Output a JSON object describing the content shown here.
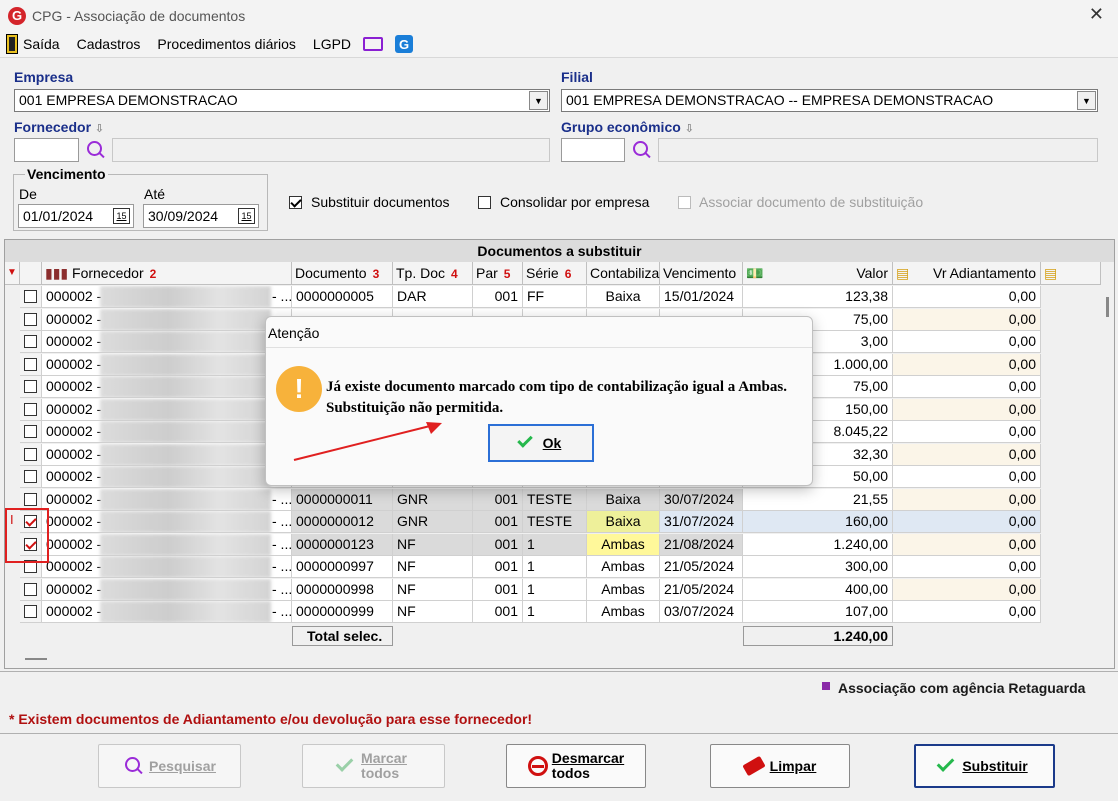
{
  "window": {
    "title": "CPG - Associação de documentos"
  },
  "menu": {
    "items": [
      "Saída",
      "Cadastros",
      "Procedimentos diários",
      "LGPD"
    ]
  },
  "empresa": {
    "label": "Empresa",
    "value": "001 EMPRESA DEMONSTRACAO"
  },
  "filial": {
    "label": "Filial",
    "value": "001 EMPRESA DEMONSTRACAO -- EMPRESA DEMONSTRACAO"
  },
  "fornecedor": {
    "label": "Fornecedor"
  },
  "grupo": {
    "label": "Grupo econômico"
  },
  "vencimento": {
    "label": "Vencimento",
    "de_label": "De",
    "de_value": "01/01/2024",
    "ate_label": "Até",
    "ate_value": "30/09/2024",
    "cal": "15"
  },
  "options": {
    "substituir": "Substituir documentos",
    "consolidar": "Consolidar por empresa",
    "associar": "Associar documento de substituição"
  },
  "grid": {
    "title": "Documentos a substituir",
    "headers": {
      "fornecedor": "Fornecedor",
      "documento": "Documento",
      "tpdoc": "Tp. Doc",
      "par": "Par",
      "serie": "Série",
      "contabiliza": "Contabiliza",
      "vencimento": "Vencimento",
      "valor": "Valor",
      "vradiant": "Vr Adiantamento"
    },
    "rows": [
      {
        "forn": "000002 -",
        "tail": "- ...",
        "doc": "0000000005",
        "tp": "DAR",
        "par": "001",
        "serie": "FF",
        "cont": "Baixa",
        "venc": "15/01/2024",
        "valor": "123,38",
        "vr": "0,00"
      },
      {
        "forn": "000002 -",
        "tail": "",
        "doc": "",
        "tp": "",
        "par": "",
        "serie": "",
        "cont": "",
        "venc": "",
        "valor": "75,00",
        "vr": "0,00"
      },
      {
        "forn": "000002 -",
        "tail": "",
        "doc": "",
        "tp": "",
        "par": "",
        "serie": "",
        "cont": "",
        "venc": "",
        "valor": "3,00",
        "vr": "0,00"
      },
      {
        "forn": "000002 -",
        "tail": "",
        "doc": "",
        "tp": "",
        "par": "",
        "serie": "",
        "cont": "",
        "venc": "",
        "valor": "1.000,00",
        "vr": "0,00"
      },
      {
        "forn": "000002 -",
        "tail": "",
        "doc": "",
        "tp": "",
        "par": "",
        "serie": "",
        "cont": "",
        "venc": "",
        "valor": "75,00",
        "vr": "0,00"
      },
      {
        "forn": "000002 -",
        "tail": "",
        "doc": "",
        "tp": "",
        "par": "",
        "serie": "",
        "cont": "",
        "venc": "",
        "valor": "150,00",
        "vr": "0,00"
      },
      {
        "forn": "000002 -",
        "tail": "",
        "doc": "",
        "tp": "",
        "par": "",
        "serie": "",
        "cont": "",
        "venc": "",
        "valor": "8.045,22",
        "vr": "0,00"
      },
      {
        "forn": "000002 -",
        "tail": "",
        "doc": "",
        "tp": "",
        "par": "",
        "serie": "",
        "cont": "",
        "venc": "",
        "valor": "32,30",
        "vr": "0,00"
      },
      {
        "forn": "000002 -",
        "tail": "",
        "doc": "",
        "tp": "",
        "par": "",
        "serie": "",
        "cont": "",
        "venc": "",
        "valor": "50,00",
        "vr": "0,00"
      },
      {
        "forn": "000002 -",
        "tail": "- ...",
        "doc": "0000000011",
        "tp": "GNR",
        "par": "001",
        "serie": "TESTE",
        "cont": "Baixa",
        "venc": "30/07/2024",
        "valor": "21,55",
        "vr": "0,00"
      },
      {
        "forn": "000002 -",
        "tail": "- ...",
        "doc": "0000000012",
        "tp": "GNR",
        "par": "001",
        "serie": "TESTE",
        "cont": "Baixa",
        "venc": "31/07/2024",
        "valor": "160,00",
        "vr": "0,00"
      },
      {
        "forn": "000002 -",
        "tail": "- ...",
        "doc": "0000000123",
        "tp": "NF",
        "par": "001",
        "serie": "1",
        "cont": "Ambas",
        "venc": "21/08/2024",
        "valor": "1.240,00",
        "vr": "0,00"
      },
      {
        "forn": "000002 -",
        "tail": "- ...",
        "doc": "0000000997",
        "tp": "NF",
        "par": "001",
        "serie": "1",
        "cont": "Ambas",
        "venc": "21/05/2024",
        "valor": "300,00",
        "vr": "0,00"
      },
      {
        "forn": "000002 -",
        "tail": "- ...",
        "doc": "0000000998",
        "tp": "NF",
        "par": "001",
        "serie": "1",
        "cont": "Ambas",
        "venc": "21/05/2024",
        "valor": "400,00",
        "vr": "0,00"
      },
      {
        "forn": "000002 -",
        "tail": "- ...",
        "doc": "0000000999",
        "tp": "NF",
        "par": "001",
        "serie": "1",
        "cont": "Ambas",
        "venc": "03/07/2024",
        "valor": "107,00",
        "vr": "0,00"
      }
    ],
    "total_label": "Total selec.",
    "total_value": "1.240,00"
  },
  "dialog": {
    "title": "Atenção",
    "line1": "Já existe documento marcado com tipo de contabilização igual a Ambas.",
    "line2": "Substituição não permitida.",
    "ok": "Ok"
  },
  "legend": {
    "agencia": "Associação com agência Retaguarda",
    "aviso": "* Existem documentos de Adiantamento e/ou devolução para esse fornecedor!"
  },
  "buttons": {
    "pesquisar": "Pesquisar",
    "marcar1": "Marcar",
    "marcar2": "todos",
    "desmarcar1": "Desmarcar",
    "desmarcar2": "todos",
    "limpar": "Limpar",
    "substituir": "Substituir"
  }
}
